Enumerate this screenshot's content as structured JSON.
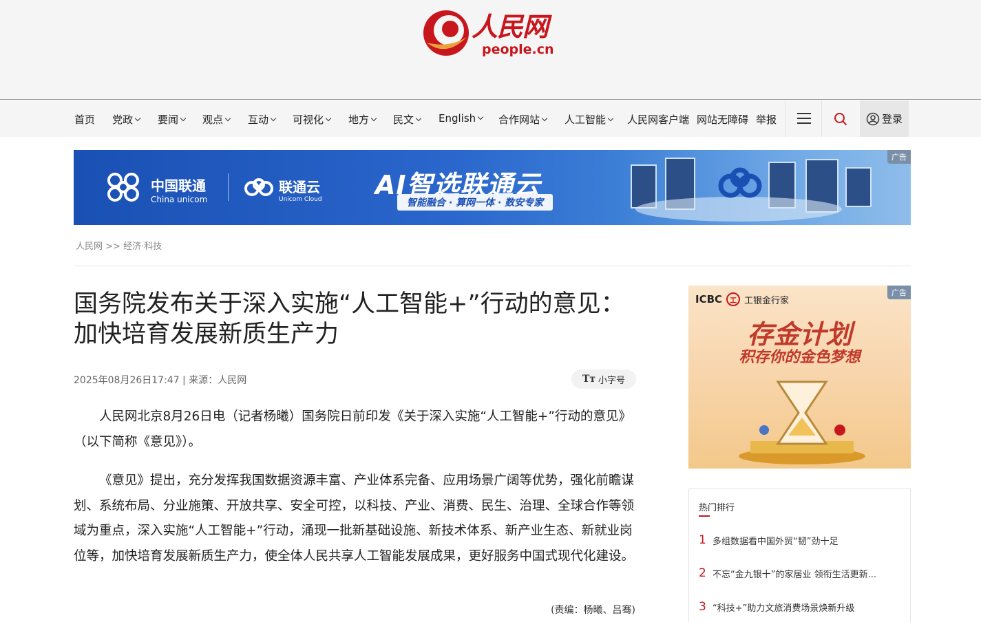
{
  "header": {
    "logo_cn": "人民网",
    "logo_en": "people.cn"
  },
  "nav": {
    "items": [
      {
        "label": "首页",
        "caret": false
      },
      {
        "label": "党政",
        "caret": true
      },
      {
        "label": "要闻",
        "caret": true
      },
      {
        "label": "观点",
        "caret": true
      },
      {
        "label": "互动",
        "caret": true
      },
      {
        "label": "可视化",
        "caret": true
      },
      {
        "label": "地方",
        "caret": true
      },
      {
        "label": "民文",
        "caret": true
      },
      {
        "label": "English",
        "caret": true
      },
      {
        "label": "合作网站",
        "caret": true
      },
      {
        "label": "人工智能",
        "caret": true
      },
      {
        "label": "人民网客户端",
        "caret": false
      },
      {
        "label": "网站无障碍",
        "caret": false
      },
      {
        "label": "举报",
        "caret": false
      }
    ],
    "menu_icon": "hamburger-icon",
    "search_icon": "search-icon",
    "login_label": "登录"
  },
  "banner_ad": {
    "tag": "广告",
    "brand_cn": "中国联通",
    "brand_en": "China unicom",
    "cloud_cn": "联通云",
    "cloud_en": "Unicom Cloud",
    "headline": "AI智选联通云",
    "subline": "智能融合 · 算网一体 · 数安专家",
    "accent_color": "#1a50b4"
  },
  "breadcrumb": {
    "home": "人民网",
    "sep": ">>",
    "section": "经济·科技"
  },
  "article": {
    "title": "国务院发布关于深入实施“人工智能+”行动的意见：加快培育发展新质生产力",
    "meta": "2025年08月26日17:47 | 来源：人民网",
    "font_toggle_icon": "Tт",
    "font_toggle_label": "小字号",
    "paragraphs": [
      "人民网北京8月26日电（记者杨曦）国务院日前印发《关于深入实施“人工智能+”行动的意见》（以下简称《意见》）。",
      "《意见》提出，充分发挥我国数据资源丰富、产业体系完备、应用场景广阔等优势，强化前瞻谋划、系统布局、分业施策、开放共享、安全可控，以科技、产业、消费、民生、治理、全球合作等领域为重点，深入实施“人工智能+”行动，涌现一批新基础设施、新技术体系、新产业生态、新就业岗位等，加快培育发展新质生产力，使全体人民共享人工智能发展成果，更好服务中国式现代化建设。"
    ],
    "editor": "(责编：杨曦、吕骞)"
  },
  "side_ad": {
    "tag": "广告",
    "brand": "ICBC",
    "brand_badge": "工",
    "brand_sub": "工银金行家",
    "title": "存金计划",
    "subtitle": "积存你的金色梦想"
  },
  "hot_list": {
    "title": "热门排行",
    "items": [
      {
        "rank": "1",
        "text": "多组数据看中国外贸“韧”劲十足"
      },
      {
        "rank": "2",
        "text": "不忘“金九银十”的家居业 领衔生活更新..."
      },
      {
        "rank": "3",
        "text": "“科技+”助力文旅消费场景焕新升级"
      }
    ]
  },
  "colors": {
    "brand_red": "#c8161d",
    "header_bg": "#f5f5f5"
  }
}
